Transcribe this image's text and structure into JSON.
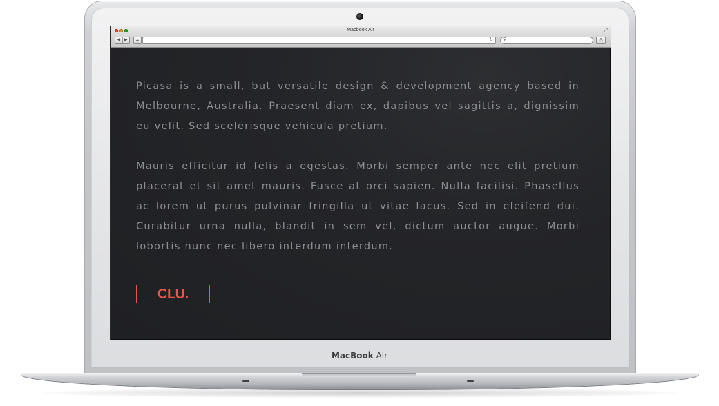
{
  "device": {
    "bezel_brand": "MacBook",
    "bezel_model": "Air"
  },
  "browser": {
    "window_title": "Macbook Air",
    "back_icon": "◀",
    "forward_icon": "▶",
    "add_icon": "+",
    "reload_icon": "↻",
    "search_icon": "⚲",
    "settings_icon": "⚙",
    "resize_icon": "⤢"
  },
  "page": {
    "paragraphs": [
      "Picasa is a small, but versatile design & development agency based in Melbourne, Australia. Praesent diam ex, dapibus vel sagittis a, dignissim eu velit. Sed scelerisque vehicula pretium.",
      "Mauris efficitur id felis a egestas. Morbi semper ante nec elit pretium placerat et sit amet mauris. Fusce at orci sapien. Nulla facilisi. Phasellus ac lorem ut purus pulvinar fringilla ut vitae lacus. Sed in eleifend dui. Curabitur urna nulla, blandit in sem vel, dictum auctor augue. Morbi lobortis nunc nec libero interdum interdum."
    ],
    "logo_text": "CLU."
  },
  "colors": {
    "accent": "#e8574a",
    "page_background": "#242528",
    "body_text": "#8c8e93"
  }
}
